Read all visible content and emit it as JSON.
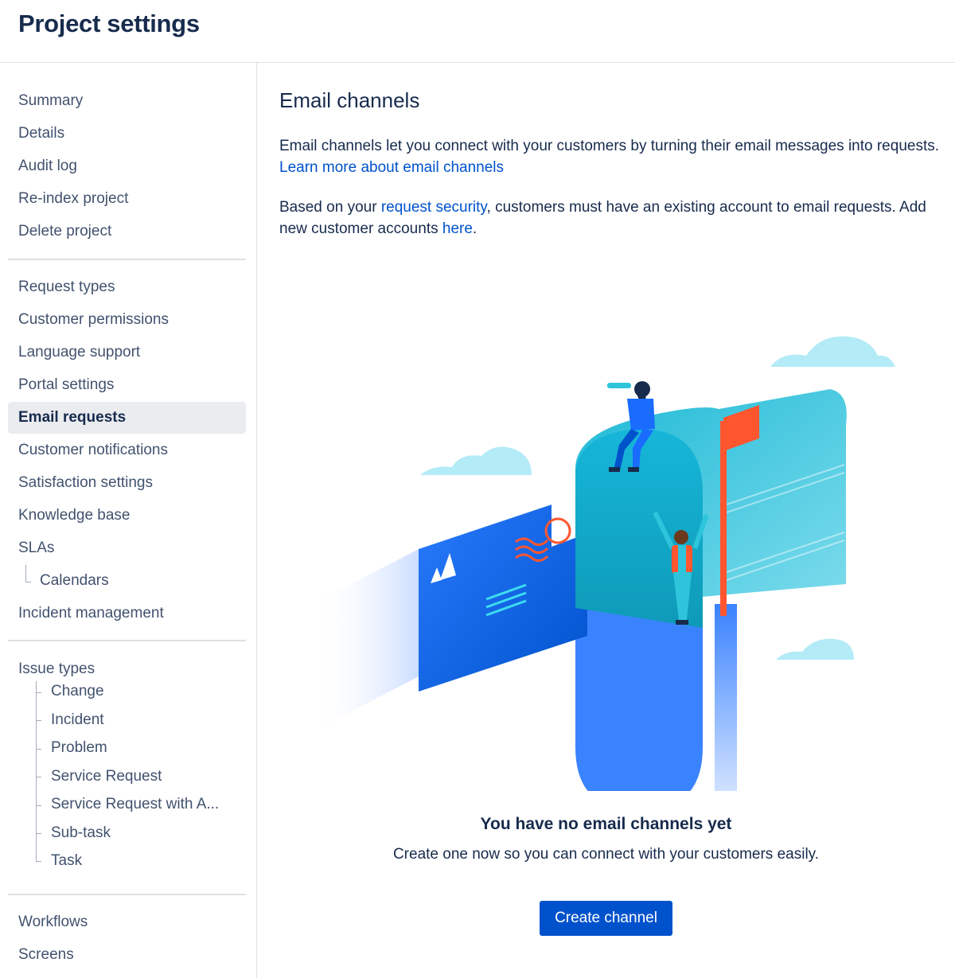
{
  "header": {
    "title": "Project settings"
  },
  "sidebar": {
    "group1": [
      "Summary",
      "Details",
      "Audit log",
      "Re-index project",
      "Delete project"
    ],
    "group2": [
      "Request types",
      "Customer permissions",
      "Language support",
      "Portal settings",
      "Email requests",
      "Customer notifications",
      "Satisfaction settings",
      "Knowledge base",
      "SLAs"
    ],
    "sla_child": "Calendars",
    "incident": "Incident management",
    "issue_types": {
      "label": "Issue types",
      "children": [
        "Change",
        "Incident",
        "Problem",
        "Service Request",
        "Service Request with A...",
        "Sub-task",
        "Task"
      ]
    },
    "group4": [
      "Workflows",
      "Screens"
    ],
    "selected": "Email requests"
  },
  "main": {
    "title": "Email channels",
    "intro_text": "Email channels let you connect with your customers by turning their email messages into requests.",
    "intro_link": "Learn more about email channels",
    "security_prefix": "Based on your",
    "security_link": "request security",
    "security_suffix": ", customers must have an existing account to email requests. Add new customer accounts",
    "here_link": "here",
    "period": ".",
    "empty_title": "You have no email channels yet",
    "empty_subtitle": "Create one now so you can connect with your customers easily.",
    "create_button": "Create channel"
  },
  "colors": {
    "primary": "#0052cc",
    "selected_bg": "#ebecf0",
    "text": "#172b4d",
    "nav_text": "#42526e",
    "mailbox_teal": "#2ec5dc",
    "flag_red": "#ff5630",
    "envelope_blue": "#1a6cff"
  },
  "icons": {
    "illustration": "mailbox-illustration",
    "logo": "atlassian-logo-icon"
  }
}
